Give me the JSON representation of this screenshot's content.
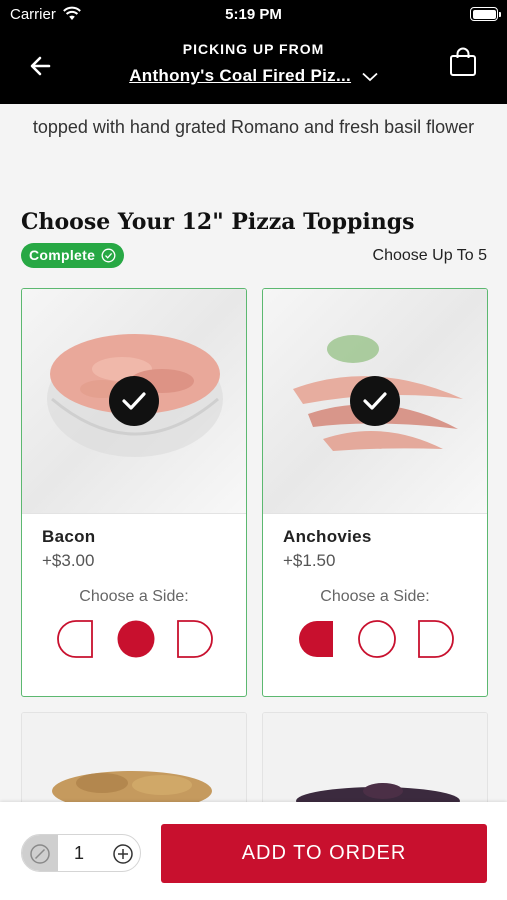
{
  "status_bar": {
    "carrier": "Carrier",
    "time": "5:19 PM"
  },
  "header": {
    "picking_up_label": "PICKING UP FROM",
    "store_name": "Anthony's Coal Fired Piz..."
  },
  "description": "topped with hand grated Romano and fresh basil flower",
  "toppings": {
    "title": "Choose Your 12\" Pizza Toppings",
    "status_badge": "Complete",
    "limit_text": "Choose Up To 5",
    "items": [
      {
        "name": "Bacon",
        "price": "+$3.00",
        "side_label": "Choose a Side:",
        "selected_side": "whole"
      },
      {
        "name": "Anchovies",
        "price": "+$1.50",
        "side_label": "Choose a Side:",
        "selected_side": "left"
      }
    ]
  },
  "order": {
    "quantity": "1",
    "add_button": "ADD TO ORDER"
  },
  "colors": {
    "accent": "#c8102e",
    "success": "#27a844",
    "header": "#000000"
  }
}
